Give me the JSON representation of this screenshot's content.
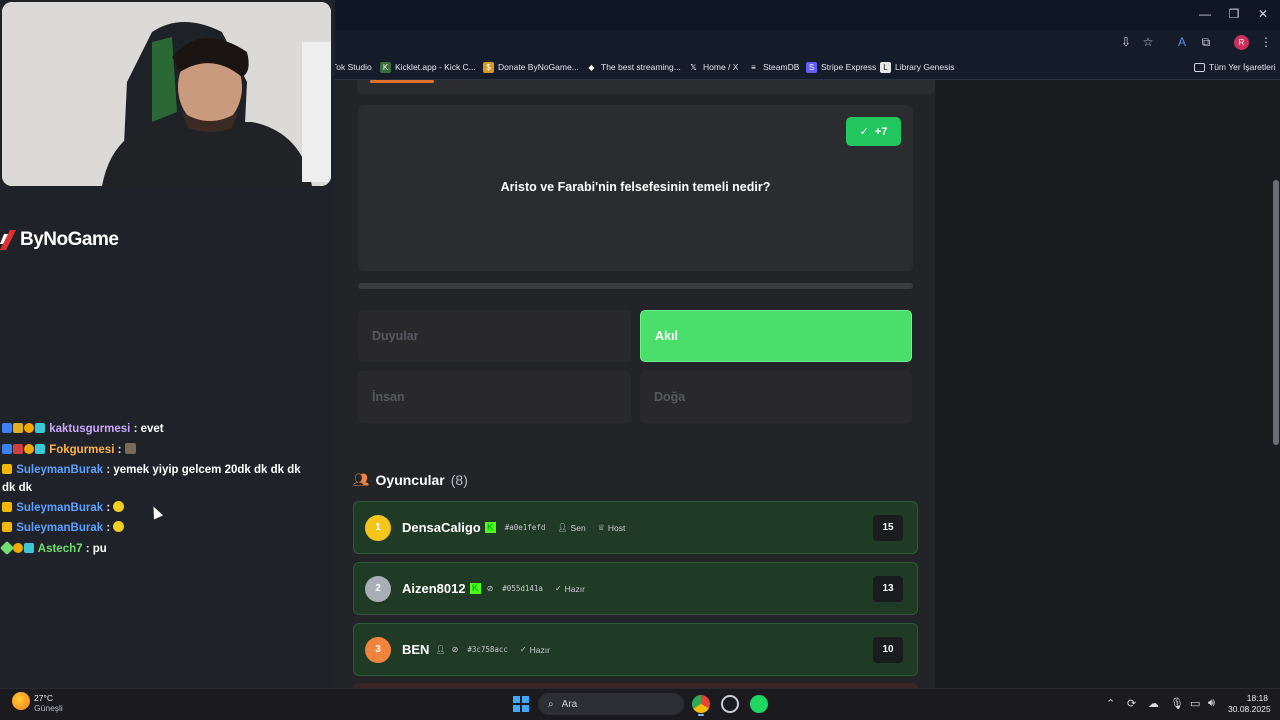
{
  "browser": {
    "bookmarks": [
      {
        "label": "Tok Studio",
        "icon": "tiktok-icon"
      },
      {
        "label": "Kicklet.app - Kick C...",
        "icon": "kicklet-icon"
      },
      {
        "label": "Donate ByNoGame...",
        "icon": "donate-icon"
      },
      {
        "label": "The best streaming...",
        "icon": "diamond-icon"
      },
      {
        "label": "Home / X",
        "icon": "x-icon"
      },
      {
        "label": "SteamDB",
        "icon": "steamdb-icon"
      },
      {
        "label": "Stripe Express",
        "icon": "stripe-icon"
      },
      {
        "label": "Library Genesis",
        "icon": "book-icon"
      }
    ],
    "all_bookmarks": "Tüm Yer İşaretleri",
    "profile_initial": "R"
  },
  "overlay": {
    "logo_text": "ByNoGame",
    "chat": [
      {
        "user": "kaktusgurmesi",
        "color": "#c9a6ff",
        "message": ": evet"
      },
      {
        "user": "Fokgurmesi",
        "color": "#ffb347",
        "message": ": "
      },
      {
        "user": "SuleymanBurak",
        "color": "#5aa0ff",
        "message": ": yemek yiyip gelcem 20dk dk dk dk dk dk"
      },
      {
        "user": "SuleymanBurak",
        "color": "#5aa0ff",
        "message": ": "
      },
      {
        "user": "SuleymanBurak",
        "color": "#5aa0ff",
        "message": ": "
      },
      {
        "user": "Astech7",
        "color": "#6ee06e",
        "message": ": pu"
      }
    ]
  },
  "quiz": {
    "points_badge": "+7",
    "question": "Aristo ve Farabi'nin felsefesinin temeli nedir?",
    "answers": [
      {
        "label": "Duyular",
        "correct": false
      },
      {
        "label": "Akıl",
        "correct": true
      },
      {
        "label": "İnsan",
        "correct": false
      },
      {
        "label": "Doğa",
        "correct": false
      }
    ],
    "accent_color": "#4ade6a"
  },
  "players": {
    "title": "Oyuncular",
    "count": "(8)",
    "list": [
      {
        "rank": "1",
        "name": "DensaCaligo",
        "id": "#a0e1fefd",
        "tags": [
          "Sen",
          "Host"
        ],
        "score": "15",
        "rank_color": "#f5c518"
      },
      {
        "rank": "2",
        "name": "Aizen8012",
        "id": "#055d141a",
        "tags": [
          "Hazır"
        ],
        "score": "13",
        "rank_color": "#a9adb5"
      },
      {
        "rank": "3",
        "name": "BEN",
        "id": "#3c758acc",
        "tags": [
          "Hazır"
        ],
        "score": "10",
        "rank_color": "#f0843c"
      }
    ]
  },
  "taskbar": {
    "weather_temp": "27°C",
    "weather_desc": "Güneşli",
    "search_placeholder": "Ara",
    "time": "18:18",
    "date": "30.08.2025"
  }
}
